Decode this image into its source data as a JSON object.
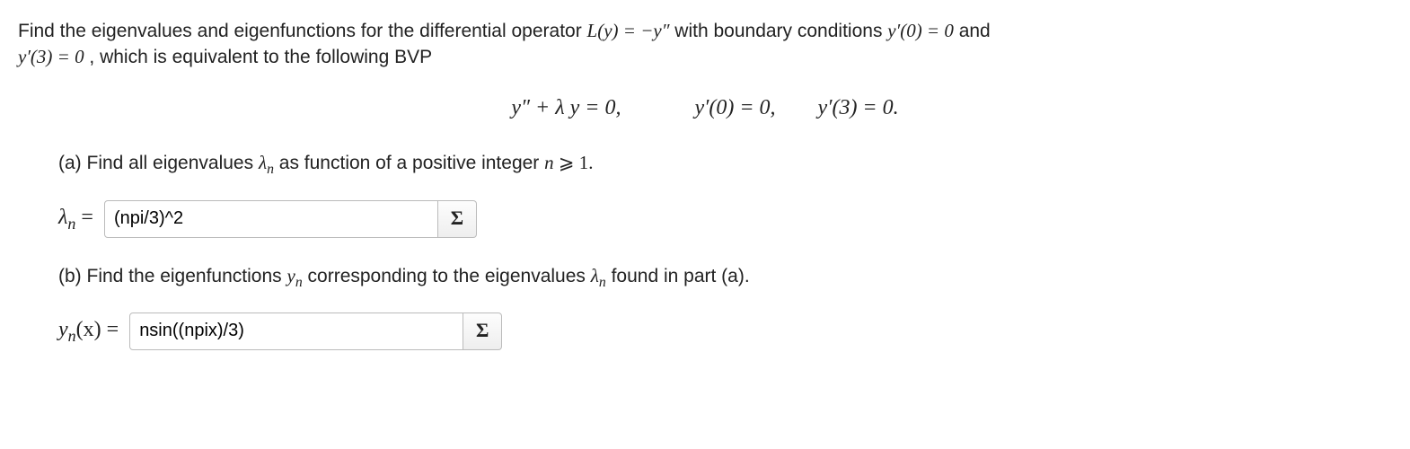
{
  "problem": {
    "line1_pre": "Find the eigenvalues and eigenfunctions for the differential operator ",
    "operator": "L(y) = −y″",
    "line1_mid": " with boundary conditions ",
    "bc1": "y′(0) = 0",
    "line1_post": " and",
    "line2_pre": "",
    "bc2": "y′(3) = 0",
    "line2_post": ", which is equivalent to the following BVP"
  },
  "display_eq": {
    "eq1": "y″ + λ y = 0,",
    "eq2": "y′(0) = 0,",
    "eq3": "y′(3) = 0."
  },
  "part_a": {
    "text_pre": "(a) Find all eigenvalues ",
    "lambda_n": "λ",
    "sub_n": "n",
    "text_mid": " as function of a positive integer ",
    "n_var": "n",
    "geq": " ⩾ 1.",
    "answer_label_sym": "λ",
    "answer_label_sub": "n",
    "answer_label_eq": " =",
    "input_value": "(npi/3)^2"
  },
  "part_b": {
    "text_pre": "(b) Find the eigenfunctions ",
    "yn_sym": "y",
    "yn_sub": "n",
    "text_mid": " corresponding to the eigenvalues ",
    "lambda_sym": "λ",
    "lambda_sub": "n",
    "text_post": " found in part (a).",
    "answer_label_sym": "y",
    "answer_label_sub": "n",
    "answer_label_x": "(x)",
    "answer_label_eq": " =",
    "input_value": "nsin((npix)/3)"
  },
  "sigma": "Σ"
}
